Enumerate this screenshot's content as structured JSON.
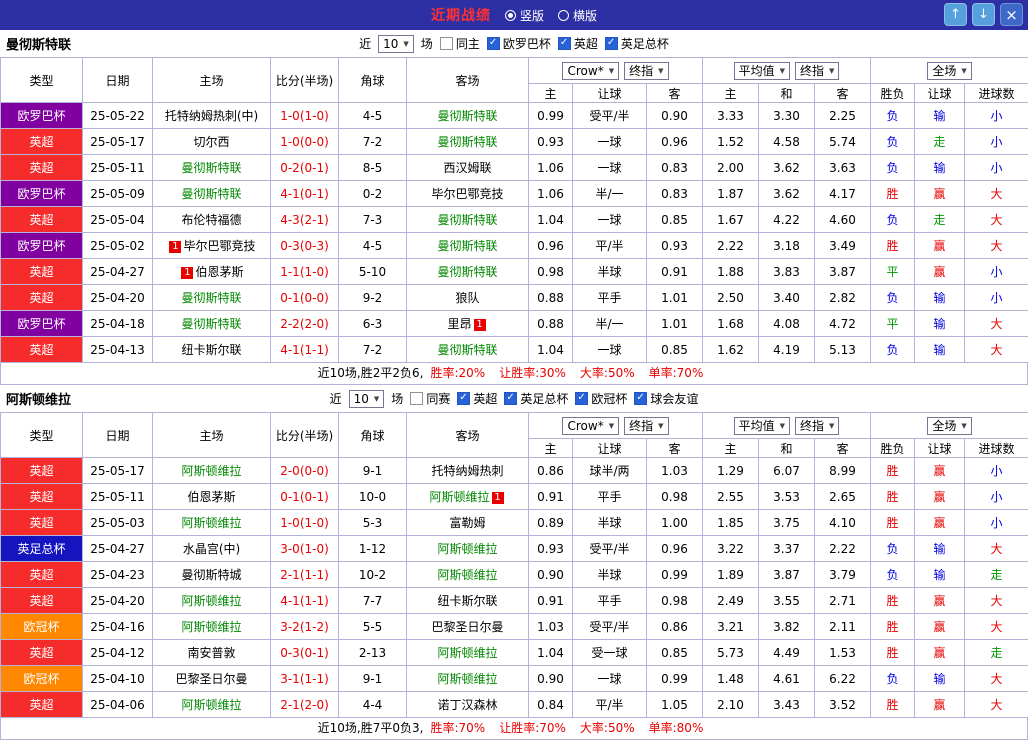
{
  "topbar": {
    "title": "近期战绩",
    "radio_vertical": "竖版",
    "radio_horizontal": "横版",
    "selected": "竖版",
    "up_icon": "↑",
    "down_icon": "↓",
    "close_icon": "×"
  },
  "filter_labels": {
    "near": "近",
    "games": "场"
  },
  "controls": {
    "crow": "Crow*",
    "final1": "终指",
    "avg": "平均值",
    "final2": "终指",
    "full": "全场"
  },
  "table_header": {
    "type": "类型",
    "date": "日期",
    "home": "主场",
    "score": "比分(半场)",
    "corner": "角球",
    "away": "客场",
    "sub_home": "主",
    "sub_handicap": "让球",
    "sub_away": "客",
    "sub_draw": "和",
    "sub_wdl": "胜负",
    "sub_goals": "进球数"
  },
  "type_colors": {
    "英超": "#f62b2b",
    "欧罗巴杯": "#8000a0",
    "英足总杯": "#1515c0",
    "欧冠杯": "#ff8800",
    "球会友谊": "#888888"
  },
  "result_colors": {
    "胜": "#e80000",
    "平": "#009900",
    "负": "#0000e0",
    "赢": "#e80000",
    "走": "#009900",
    "输": "#0000e0",
    "大": "#e80000",
    "小": "#0000e0"
  },
  "sections": [
    {
      "team": "曼彻斯特联",
      "near_count": "10",
      "filters": [
        {
          "label": "同主",
          "checked": false
        },
        {
          "label": "欧罗巴杯",
          "checked": true
        },
        {
          "label": "英超",
          "checked": true
        },
        {
          "label": "英足总杯",
          "checked": true
        }
      ],
      "rows": [
        {
          "type": "欧罗巴杯",
          "date": "25-05-22",
          "home": "托特纳姆热刺(中)",
          "away": "曼彻斯特联",
          "focus": "away",
          "score": "1-0(1-0)",
          "corner": "4-5",
          "o1": "0.99",
          "hcap": "受平/半",
          "o2": "0.90",
          "a1": "3.33",
          "a2": "3.30",
          "a3": "2.25",
          "res": "负",
          "hres": "输",
          "gres": "小"
        },
        {
          "type": "英超",
          "date": "25-05-17",
          "home": "切尔西",
          "away": "曼彻斯特联",
          "focus": "away",
          "score": "1-0(0-0)",
          "corner": "7-2",
          "o1": "0.93",
          "hcap": "一球",
          "o2": "0.96",
          "a1": "1.52",
          "a2": "4.58",
          "a3": "5.74",
          "res": "负",
          "hres": "走",
          "gres": "小"
        },
        {
          "type": "英超",
          "date": "25-05-11",
          "home": "曼彻斯特联",
          "away": "西汉姆联",
          "focus": "home",
          "score": "0-2(0-1)",
          "corner": "8-5",
          "o1": "1.06",
          "hcap": "一球",
          "o2": "0.83",
          "a1": "2.00",
          "a2": "3.62",
          "a3": "3.63",
          "res": "负",
          "hres": "输",
          "gres": "小"
        },
        {
          "type": "欧罗巴杯",
          "date": "25-05-09",
          "home": "曼彻斯特联",
          "away": "毕尔巴鄂竞技",
          "focus": "home",
          "score": "4-1(0-1)",
          "corner": "0-2",
          "o1": "1.06",
          "hcap": "半/一",
          "o2": "0.83",
          "a1": "1.87",
          "a2": "3.62",
          "a3": "4.17",
          "res": "胜",
          "hres": "赢",
          "gres": "大"
        },
        {
          "type": "英超",
          "date": "25-05-04",
          "home": "布伦特福德",
          "away": "曼彻斯特联",
          "focus": "away",
          "score": "4-3(2-1)",
          "corner": "7-3",
          "o1": "1.04",
          "hcap": "一球",
          "o2": "0.85",
          "a1": "1.67",
          "a2": "4.22",
          "a3": "4.60",
          "res": "负",
          "hres": "走",
          "gres": "大"
        },
        {
          "type": "欧罗巴杯",
          "date": "25-05-02",
          "home": "毕尔巴鄂竞技",
          "home_badge": "1",
          "home_badge_side": "left",
          "away": "曼彻斯特联",
          "focus": "away",
          "score": "0-3(0-3)",
          "corner": "4-5",
          "o1": "0.96",
          "hcap": "平/半",
          "o2": "0.93",
          "a1": "2.22",
          "a2": "3.18",
          "a3": "3.49",
          "res": "胜",
          "hres": "赢",
          "gres": "大"
        },
        {
          "type": "英超",
          "date": "25-04-27",
          "home": "伯恩茅斯",
          "home_badge": "1",
          "home_badge_side": "left",
          "away": "曼彻斯特联",
          "focus": "away",
          "score": "1-1(1-0)",
          "corner": "5-10",
          "o1": "0.98",
          "hcap": "半球",
          "o2": "0.91",
          "a1": "1.88",
          "a2": "3.83",
          "a3": "3.87",
          "res": "平",
          "hres": "赢",
          "gres": "小"
        },
        {
          "type": "英超",
          "date": "25-04-20",
          "home": "曼彻斯特联",
          "away": "狼队",
          "focus": "home",
          "score": "0-1(0-0)",
          "corner": "9-2",
          "o1": "0.88",
          "hcap": "平手",
          "o2": "1.01",
          "a1": "2.50",
          "a2": "3.40",
          "a3": "2.82",
          "res": "负",
          "hres": "输",
          "gres": "小"
        },
        {
          "type": "欧罗巴杯",
          "date": "25-04-18",
          "home": "曼彻斯特联",
          "away": "里昂",
          "away_badge": "1",
          "away_badge_side": "right",
          "focus": "home",
          "score": "2-2(2-0)",
          "corner": "6-3",
          "o1": "0.88",
          "hcap": "半/一",
          "o2": "1.01",
          "a1": "1.68",
          "a2": "4.08",
          "a3": "4.72",
          "res": "平",
          "hres": "输",
          "gres": "大"
        },
        {
          "type": "英超",
          "date": "25-04-13",
          "home": "纽卡斯尔联",
          "away": "曼彻斯特联",
          "focus": "away",
          "score": "4-1(1-1)",
          "corner": "7-2",
          "o1": "1.04",
          "hcap": "一球",
          "o2": "0.85",
          "a1": "1.62",
          "a2": "4.19",
          "a3": "5.13",
          "res": "负",
          "hres": "输",
          "gres": "大"
        }
      ],
      "summary": {
        "prefix": "近10场,胜2平2负6,",
        "stats": [
          "胜率:20%",
          "让胜率:30%",
          "大率:50%",
          "单率:70%"
        ]
      }
    },
    {
      "team": "阿斯顿维拉",
      "near_count": "10",
      "filters": [
        {
          "label": "同赛",
          "checked": false
        },
        {
          "label": "英超",
          "checked": true
        },
        {
          "label": "英足总杯",
          "checked": true
        },
        {
          "label": "欧冠杯",
          "checked": true
        },
        {
          "label": "球会友谊",
          "checked": true
        }
      ],
      "rows": [
        {
          "type": "英超",
          "date": "25-05-17",
          "home": "阿斯顿维拉",
          "focus": "home",
          "away": "托特纳姆热刺",
          "score": "2-0(0-0)",
          "corner": "9-1",
          "o1": "0.86",
          "hcap": "球半/两",
          "o2": "1.03",
          "a1": "1.29",
          "a2": "6.07",
          "a3": "8.99",
          "res": "胜",
          "hres": "赢",
          "gres": "小"
        },
        {
          "type": "英超",
          "date": "25-05-11",
          "home": "伯恩茅斯",
          "away": "阿斯顿维拉",
          "away_badge": "1",
          "away_badge_side": "right",
          "focus": "away",
          "score": "0-1(0-1)",
          "corner": "10-0",
          "o1": "0.91",
          "hcap": "平手",
          "o2": "0.98",
          "a1": "2.55",
          "a2": "3.53",
          "a3": "2.65",
          "res": "胜",
          "hres": "赢",
          "gres": "小"
        },
        {
          "type": "英超",
          "date": "25-05-03",
          "home": "阿斯顿维拉",
          "focus": "home",
          "away": "富勒姆",
          "score": "1-0(1-0)",
          "corner": "5-3",
          "o1": "0.89",
          "hcap": "半球",
          "o2": "1.00",
          "a1": "1.85",
          "a2": "3.75",
          "a3": "4.10",
          "res": "胜",
          "hres": "赢",
          "gres": "小"
        },
        {
          "type": "英足总杯",
          "date": "25-04-27",
          "home": "水晶宫(中)",
          "away": "阿斯顿维拉",
          "focus": "away",
          "score": "3-0(1-0)",
          "corner": "1-12",
          "o1": "0.93",
          "hcap": "受平/半",
          "o2": "0.96",
          "a1": "3.22",
          "a2": "3.37",
          "a3": "2.22",
          "res": "负",
          "hres": "输",
          "gres": "大"
        },
        {
          "type": "英超",
          "date": "25-04-23",
          "home": "曼彻斯特城",
          "away": "阿斯顿维拉",
          "focus": "away",
          "score": "2-1(1-1)",
          "corner": "10-2",
          "o1": "0.90",
          "hcap": "半球",
          "o2": "0.99",
          "a1": "1.89",
          "a2": "3.87",
          "a3": "3.79",
          "res": "负",
          "hres": "输",
          "gres": "走"
        },
        {
          "type": "英超",
          "date": "25-04-20",
          "home": "阿斯顿维拉",
          "focus": "home",
          "away": "纽卡斯尔联",
          "score": "4-1(1-1)",
          "corner": "7-7",
          "o1": "0.91",
          "hcap": "平手",
          "o2": "0.98",
          "a1": "2.49",
          "a2": "3.55",
          "a3": "2.71",
          "res": "胜",
          "hres": "赢",
          "gres": "大"
        },
        {
          "type": "欧冠杯",
          "date": "25-04-16",
          "home": "阿斯顿维拉",
          "focus": "home",
          "away": "巴黎圣日尔曼",
          "score": "3-2(1-2)",
          "corner": "5-5",
          "o1": "1.03",
          "hcap": "受平/半",
          "o2": "0.86",
          "a1": "3.21",
          "a2": "3.82",
          "a3": "2.11",
          "res": "胜",
          "hres": "赢",
          "gres": "大"
        },
        {
          "type": "英超",
          "date": "25-04-12",
          "home": "南安普敦",
          "away": "阿斯顿维拉",
          "focus": "away",
          "score": "0-3(0-1)",
          "corner": "2-13",
          "o1": "1.04",
          "hcap": "受一球",
          "o2": "0.85",
          "a1": "5.73",
          "a2": "4.49",
          "a3": "1.53",
          "res": "胜",
          "hres": "赢",
          "gres": "走"
        },
        {
          "type": "欧冠杯",
          "date": "25-04-10",
          "home": "巴黎圣日尔曼",
          "away": "阿斯顿维拉",
          "focus": "away",
          "score": "3-1(1-1)",
          "corner": "9-1",
          "o1": "0.90",
          "hcap": "一球",
          "o2": "0.99",
          "a1": "1.48",
          "a2": "4.61",
          "a3": "6.22",
          "res": "负",
          "hres": "输",
          "gres": "大"
        },
        {
          "type": "英超",
          "date": "25-04-06",
          "home": "阿斯顿维拉",
          "focus": "home",
          "away": "诺丁汉森林",
          "score": "2-1(2-0)",
          "corner": "4-4",
          "o1": "0.84",
          "hcap": "平/半",
          "o2": "1.05",
          "a1": "2.10",
          "a2": "3.43",
          "a3": "3.52",
          "res": "胜",
          "hres": "赢",
          "gres": "大"
        }
      ],
      "summary": {
        "prefix": "近10场,胜7平0负3,",
        "stats": [
          "胜率:70%",
          "让胜率:70%",
          "大率:50%",
          "单率:80%"
        ]
      }
    }
  ]
}
